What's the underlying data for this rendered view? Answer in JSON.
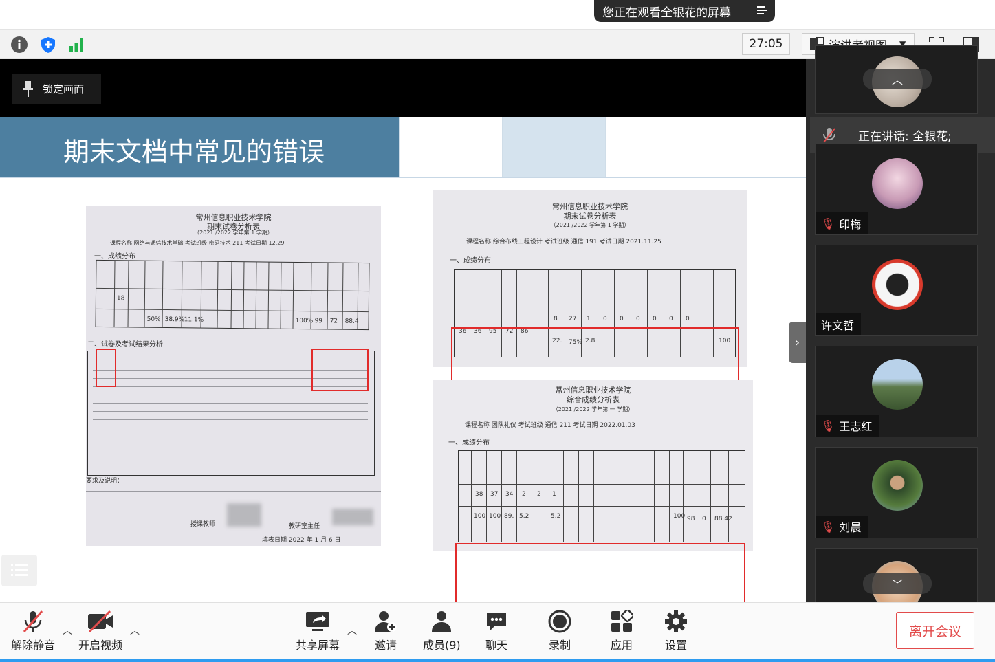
{
  "banner": {
    "text": "您正在观看全银花的屏幕",
    "menu_icon": "list-menu-icon"
  },
  "toolbar": {
    "icons": [
      "info-icon",
      "shield-icon",
      "signal-icon"
    ],
    "timer": "27:05",
    "view_mode": "演讲者视图",
    "fullscreen_icon": "fullscreen-icon",
    "layout_icon": "sidebar-layout-icon"
  },
  "screen": {
    "lock_label": "锁定画面",
    "slide_title": "期末文档中常见的错误",
    "doc1": {
      "school": "常州信息职业技术学院",
      "title": "期末试卷分析表",
      "year": "（2021 /2022 学年第 1 学期）",
      "course_line": "课程名称 网络与通信技术基础   考试班级 密码技术 211   考试日期 12.29",
      "section1": "一、成绩分布",
      "section2": "二、试卷及考试结果分析",
      "row_count": "18",
      "row_pct": [
        "50%",
        "38.9%",
        "11.1%"
      ],
      "stats": [
        "100%",
        "99",
        "72",
        "88.4"
      ],
      "footer_req": "要求及说明：",
      "teacher": "授课教师",
      "director": "教研室主任",
      "date_line": "填表日期 2022 年 1 月 6 日"
    },
    "doc2": {
      "school": "常州信息职业技术学院",
      "title": "期末试卷分析表",
      "year": "（2021 /2022 学年第 1 学期）",
      "course_line": "课程名称 综合布线工程设计   考试班级 通信 191   考试日期 2021.11.25",
      "section1": "一、成绩分布",
      "values": [
        "36",
        "36",
        "95",
        "72",
        "86",
        "8",
        "27",
        "1",
        "0",
        "0",
        "0",
        "0",
        "0",
        "0"
      ],
      "pct": [
        "22.",
        "75%",
        "2.8",
        "100"
      ]
    },
    "doc3": {
      "school": "常州信息职业技术学院",
      "title": "综合成绩分析表",
      "year": "（2021 /2022 学年第 一 学期）",
      "course_line": "课程名称 团队礼仪   考试班级 通信 211   考试日期 2022.01.03",
      "section1": "一、成绩分布",
      "values": [
        "38",
        "37",
        "34",
        "2",
        "2",
        "1"
      ],
      "pct": [
        "100",
        "100",
        "89.",
        "5.2",
        "5.2",
        "100",
        "98",
        "0",
        "88.42"
      ]
    }
  },
  "panel": {
    "speaking": "正在讲话: 全银花;",
    "participants": [
      {
        "name": "印梅",
        "muted": true
      },
      {
        "name": "许文哲",
        "muted": false
      },
      {
        "name": "王志红",
        "muted": true
      },
      {
        "name": "刘晨",
        "muted": true
      }
    ]
  },
  "bottombar": {
    "unmute": "解除静音",
    "start_video": "开启视频",
    "share_screen": "共享屏幕",
    "invite": "邀请",
    "members": "成员(9)",
    "chat": "聊天",
    "record": "录制",
    "apps": "应用",
    "settings": "设置",
    "leave": "离开会议"
  },
  "colors": {
    "slide_title_bg": "#4d7fa0",
    "leave_red": "#e24b4b",
    "panel_bg": "#2b2b2b",
    "accent_blue": "#2e9cf0"
  }
}
